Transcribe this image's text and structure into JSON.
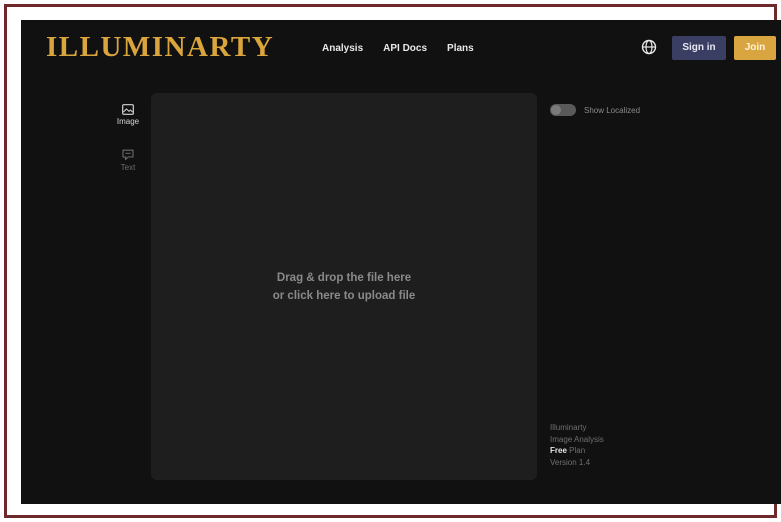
{
  "header": {
    "logo": "ILLUMINARTY",
    "nav": [
      "Analysis",
      "API Docs",
      "Plans"
    ],
    "language_icon": "globe-icon",
    "sign_in_label": "Sign in",
    "join_label": "Join"
  },
  "sidebar": {
    "items": [
      {
        "label": "Image",
        "icon": "image-icon",
        "active": true
      },
      {
        "label": "Text",
        "icon": "text-bubble-icon",
        "active": false
      }
    ]
  },
  "upload": {
    "line1": "Drag & drop the file here",
    "line2": "or click here to upload file"
  },
  "panel": {
    "toggle_label": "Show Localized",
    "toggle_on": false
  },
  "footer_info": {
    "app": "Illuminarty",
    "product": "Image Analysis",
    "plan_name": "Free",
    "plan_suffix": " Plan",
    "version": "Version 1.4"
  },
  "colors": {
    "brand_gold": "#d9a53c",
    "sign_in_bg": "#3b3e63",
    "join_bg": "#d9a540",
    "background": "#111111",
    "frame": "#6e2a2a"
  }
}
